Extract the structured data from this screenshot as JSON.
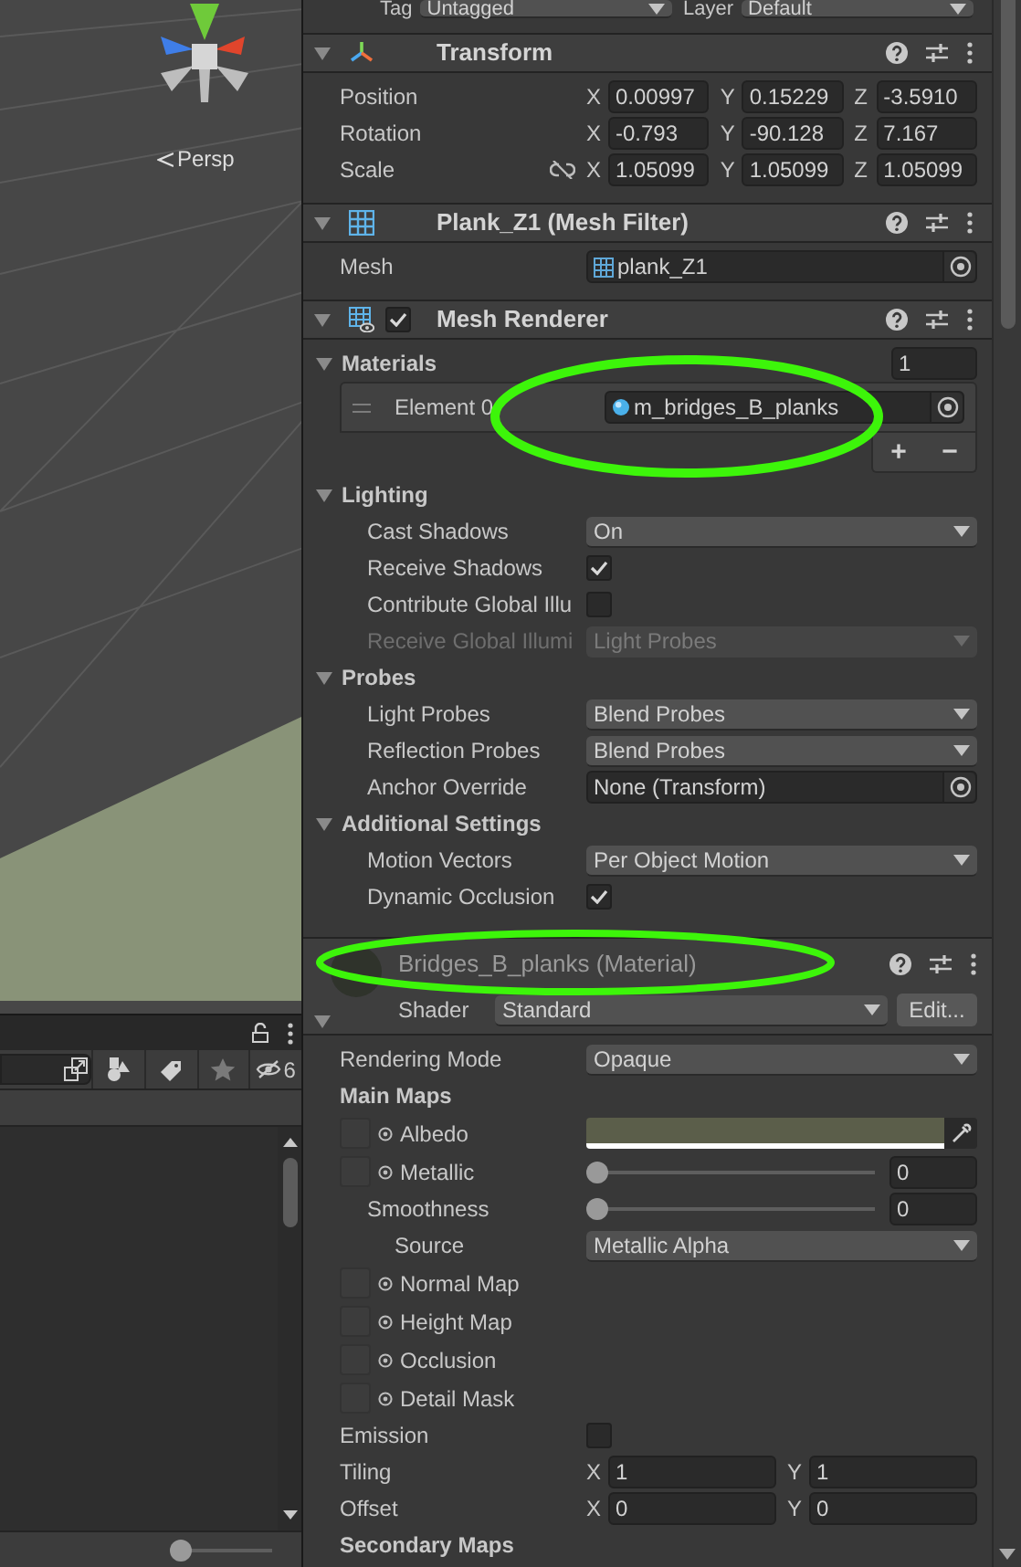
{
  "scene_view": {
    "camera_label": "Persp"
  },
  "project_panel": {
    "hidden_count": "6",
    "zoom_slider": {
      "level": 0
    }
  },
  "inspector": {
    "top_row": [
      {
        "label": "Tag",
        "value": "Untagged"
      },
      {
        "label": "Layer",
        "value": "Default"
      }
    ],
    "components": [
      {
        "kind": "component",
        "title": "Transform",
        "expanded": true,
        "rows": [
          {
            "kind": "xyz",
            "label": "Position",
            "linked": false,
            "values": [
              {
                "axis": "X",
                "value": "0.00997"
              },
              {
                "axis": "Y",
                "value": "0.15229"
              },
              {
                "axis": "Z",
                "value": "-3.5910"
              }
            ]
          },
          {
            "kind": "xyz",
            "label": "Rotation",
            "linked": false,
            "values": [
              {
                "axis": "X",
                "value": "-0.793"
              },
              {
                "axis": "Y",
                "value": "-90.128"
              },
              {
                "axis": "Z",
                "value": "7.167"
              }
            ]
          },
          {
            "kind": "xyz",
            "label": "Scale",
            "linked": true,
            "values": [
              {
                "axis": "X",
                "value": "1.05099"
              },
              {
                "axis": "Y",
                "value": "1.05099"
              },
              {
                "axis": "Z",
                "value": "1.05099"
              }
            ]
          }
        ]
      },
      {
        "kind": "component",
        "title": "Plank_Z1 (Mesh Filter)",
        "expanded": true,
        "rows": [
          {
            "kind": "object",
            "label": "Mesh",
            "value": "plank_Z1"
          }
        ]
      },
      {
        "kind": "component",
        "title": "Mesh Renderer",
        "enabled": true,
        "expanded": true,
        "rows": [
          {
            "kind": "section",
            "title": "Materials",
            "expanded": true,
            "count": "1",
            "children": [
              {
                "kind": "list_element",
                "label": "Element 0",
                "value": "m_bridges_B_planks"
              },
              {
                "kind": "list_buttons",
                "buttons": [
                  "+",
                  "−"
                ]
              }
            ]
          },
          {
            "kind": "section",
            "title": "Lighting",
            "expanded": true,
            "children": [
              {
                "kind": "dropdown",
                "label": "Cast Shadows",
                "value": "On",
                "disabled": false
              },
              {
                "kind": "checkbox",
                "label": "Receive Shadows",
                "checked": true
              },
              {
                "kind": "checkbox",
                "label": "Contribute Global Illu",
                "checked": false
              },
              {
                "kind": "dropdown",
                "label": "Receive Global Illumi",
                "value": "Light Probes",
                "disabled": true
              }
            ]
          },
          {
            "kind": "section",
            "title": "Probes",
            "expanded": true,
            "children": [
              {
                "kind": "dropdown",
                "label": "Light Probes",
                "value": "Blend Probes",
                "disabled": false
              },
              {
                "kind": "dropdown",
                "label": "Reflection Probes",
                "value": "Blend Probes",
                "disabled": false
              },
              {
                "kind": "object",
                "label": "Anchor Override",
                "value": "None (Transform)"
              }
            ]
          },
          {
            "kind": "section",
            "title": "Additional Settings",
            "expanded": true,
            "children": [
              {
                "kind": "dropdown",
                "label": "Motion Vectors",
                "value": "Per Object Motion",
                "disabled": false
              },
              {
                "kind": "checkbox",
                "label": "Dynamic Occlusion",
                "checked": true
              }
            ]
          }
        ]
      },
      {
        "kind": "material",
        "title": "Bridges_B_planks (Material)",
        "expanded": true,
        "shader_label": "Shader",
        "shader": "Standard",
        "edit_button": "Edit...",
        "rows": [
          {
            "kind": "dropdown",
            "label": "Rendering Mode",
            "value": "Opaque",
            "disabled": false
          },
          {
            "kind": "subheader",
            "label": "Main Maps"
          },
          {
            "kind": "color_texture",
            "label": "Albedo"
          },
          {
            "kind": "slider_texture",
            "label": "Metallic",
            "level": 0,
            "reading": "0",
            "children": [
              {
                "kind": "slider",
                "label": "Smoothness",
                "level": 0,
                "reading": "0",
                "children": [
                  {
                    "kind": "dropdown",
                    "label": "Source",
                    "value": "Metallic Alpha",
                    "disabled": false
                  }
                ]
              }
            ]
          },
          {
            "kind": "texture",
            "label": "Normal Map"
          },
          {
            "kind": "texture",
            "label": "Height Map"
          },
          {
            "kind": "texture",
            "label": "Occlusion"
          },
          {
            "kind": "texture",
            "label": "Detail Mask"
          },
          {
            "kind": "checkbox",
            "label": "Emission",
            "checked": false
          },
          {
            "kind": "xy",
            "label": "Tiling",
            "values": [
              {
                "axis": "X",
                "value": "1"
              },
              {
                "axis": "Y",
                "value": "1"
              }
            ]
          },
          {
            "kind": "xy",
            "label": "Offset",
            "values": [
              {
                "axis": "X",
                "value": "0"
              },
              {
                "axis": "Y",
                "value": "0"
              }
            ]
          },
          {
            "kind": "subheader",
            "label": "Secondary Maps"
          }
        ]
      }
    ]
  }
}
